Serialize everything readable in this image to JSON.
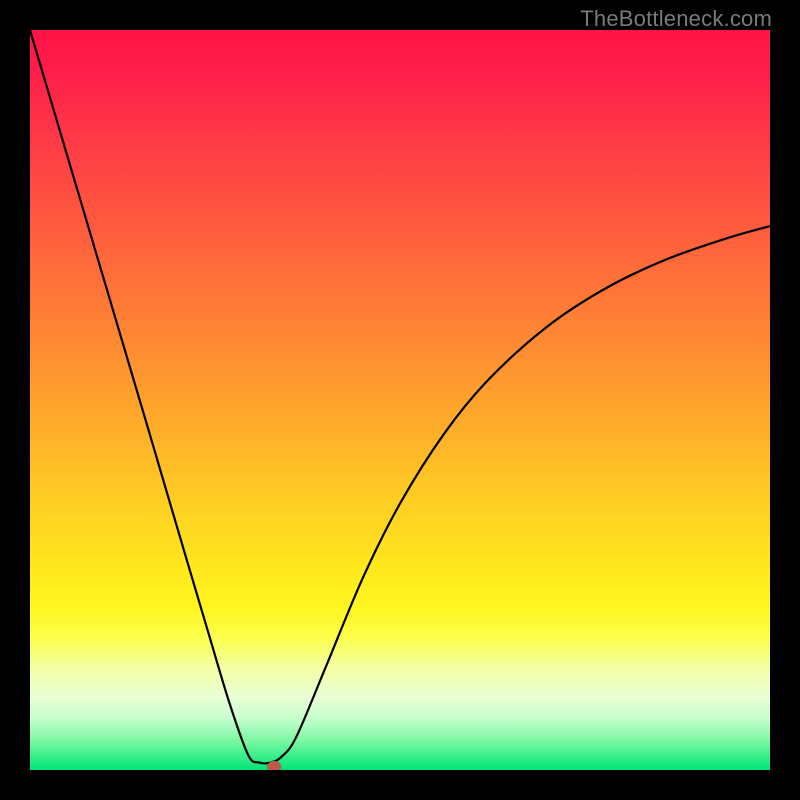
{
  "watermark": "TheBottleneck.com",
  "chart_data": {
    "type": "line",
    "title": "",
    "xlabel": "",
    "ylabel": "",
    "xlim": [
      0,
      1
    ],
    "ylim": [
      0,
      1
    ],
    "grid": false,
    "series": [
      {
        "name": "curve",
        "x": [
          0.0,
          0.04,
          0.08,
          0.12,
          0.16,
          0.2,
          0.24,
          0.27,
          0.295,
          0.31,
          0.325,
          0.34,
          0.36,
          0.4,
          0.45,
          0.5,
          0.56,
          0.62,
          0.7,
          0.78,
          0.86,
          0.94,
          1.0
        ],
        "y": [
          1.0,
          0.865,
          0.73,
          0.595,
          0.46,
          0.324,
          0.189,
          0.089,
          0.02,
          0.01,
          0.01,
          0.018,
          0.045,
          0.14,
          0.26,
          0.36,
          0.455,
          0.528,
          0.6,
          0.652,
          0.69,
          0.718,
          0.735
        ]
      }
    ],
    "marker": {
      "x": 0.33,
      "y": 0.006,
      "color": "#c25a4a"
    },
    "gradient_stops": [
      {
        "pos": 0.0,
        "color": "#ff1446"
      },
      {
        "pos": 0.5,
        "color": "#ffa22d"
      },
      {
        "pos": 0.78,
        "color": "#fff61f"
      },
      {
        "pos": 1.0,
        "color": "#00e676"
      }
    ]
  }
}
